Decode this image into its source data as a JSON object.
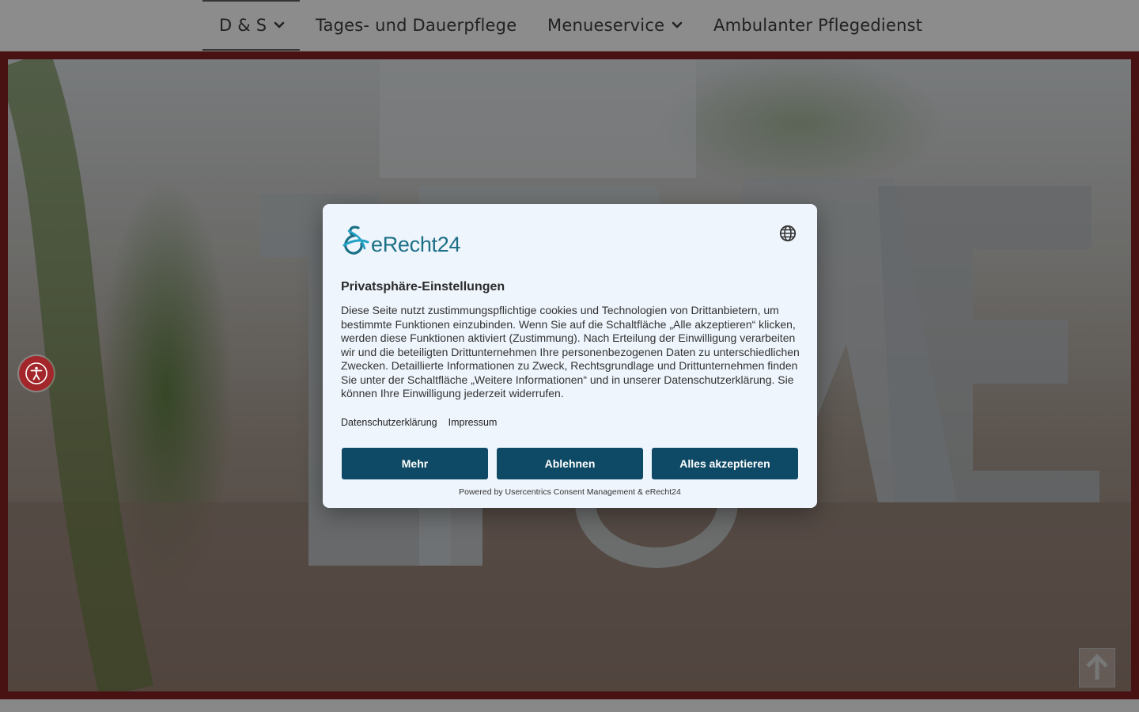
{
  "nav": {
    "items": [
      {
        "label": "D & S",
        "has_dropdown": true,
        "active": true
      },
      {
        "label": "Tages- und Dauerpflege",
        "has_dropdown": false
      },
      {
        "label": "Menueservice",
        "has_dropdown": true
      },
      {
        "label": "Ambulanter Pflegedienst",
        "has_dropdown": false
      }
    ]
  },
  "colors": {
    "frame": "#7c1f21",
    "button": "#0e4a66",
    "logo": "#1b6f86",
    "dialog_bg": "#eef5fc",
    "a11y": "#a3262a"
  },
  "consent": {
    "logo_text": "eRecht24",
    "title": "Privatsphäre-Einstellungen",
    "body": "Diese Seite nutzt zustimmungspflichtige cookies und Technologien von Drittanbietern, um bestimmte Funktionen einzubinden. Wenn Sie auf die Schaltfläche „Alle akzeptieren“ klicken, werden diese Funktionen aktiviert (Zustimmung). Nach Erteilung der Einwilligung verarbeiten wir und die beteiligten Drittunternehmen Ihre personenbezogenen Daten zu unterschiedlichen Zwecken. Detaillierte Informationen zu Zweck, Rechtsgrundlage und Drittunternehmen finden Sie unter der Schaltfläche „Weitere Informationen“ und in unserer Datenschutzerklärung. Sie können Ihre Einwilligung jederzeit widerrufen.",
    "links": {
      "privacy": "Datenschutzerklärung",
      "imprint": "Impressum"
    },
    "buttons": {
      "more": "Mehr",
      "deny": "Ablehnen",
      "accept_all": "Alles akzeptieren"
    },
    "powered_by": "Powered by Usercentrics Consent Management & eRecht24"
  },
  "icons": {
    "language": "globe-icon",
    "accessibility": "accessibility-icon",
    "back_to_top": "arrow-up-icon",
    "dropdown": "chevron-down-icon"
  }
}
